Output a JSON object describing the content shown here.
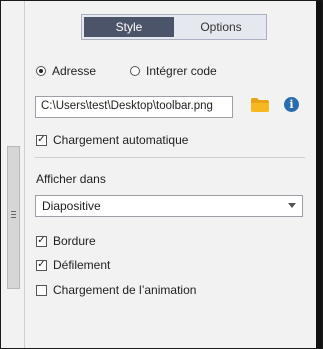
{
  "tabs": [
    {
      "label": "Style",
      "active": true
    },
    {
      "label": "Options",
      "active": false
    }
  ],
  "source": {
    "adresse_label": "Adresse",
    "adresse_selected": true,
    "integrer_label": "Intégrer code",
    "integrer_selected": false
  },
  "path_field": {
    "value": "C:\\Users\\test\\Desktop\\toolbar.png"
  },
  "icons": {
    "folder": "folder-icon",
    "info": "info-icon",
    "info_glyph": "i",
    "folder_color": "#e8a317",
    "info_color": "#2b6cb0"
  },
  "auto_load": {
    "label": "Chargement automatique",
    "checked": true
  },
  "display_in": {
    "label": "Afficher dans",
    "selected": "Diapositive"
  },
  "options": [
    {
      "label": "Bordure",
      "checked": true
    },
    {
      "label": "Défilement",
      "checked": true
    },
    {
      "label": "Chargement de l’animation",
      "checked": false
    }
  ],
  "colors": {
    "tab_active_bg": "#4b5468",
    "panel_bg": "#f2f2f2"
  }
}
